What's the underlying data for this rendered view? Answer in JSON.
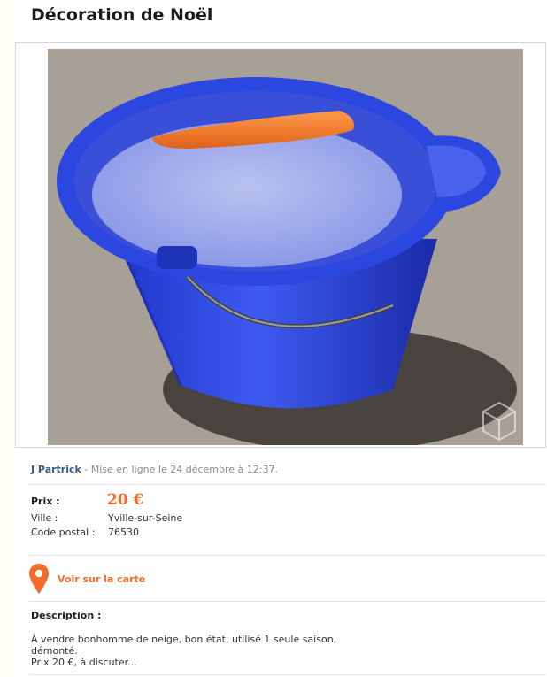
{
  "ad": {
    "title": "Décoration de Noël",
    "author": "J Partrick",
    "posted": " - Mise en ligne le 24 décembre à 12:37."
  },
  "price": {
    "label": "Prix :",
    "value": "20 €"
  },
  "details": [
    {
      "label": "Ville :",
      "value": "Yville-sur-Seine"
    },
    {
      "label": "Code postal :",
      "value": "76530"
    }
  ],
  "map": {
    "label": "Voir sur la carte",
    "icon": "map-pin-icon",
    "color": "#f56b2a"
  },
  "description": {
    "label": "Description :",
    "text": "À vendre bonhomme de neige, bon état, utilisé 1 seule saison,\ndémonté.\nPrix 20 €, à discuter..."
  },
  "colors": {
    "accent": "#f56b2a",
    "link": "#3a5a8c"
  }
}
